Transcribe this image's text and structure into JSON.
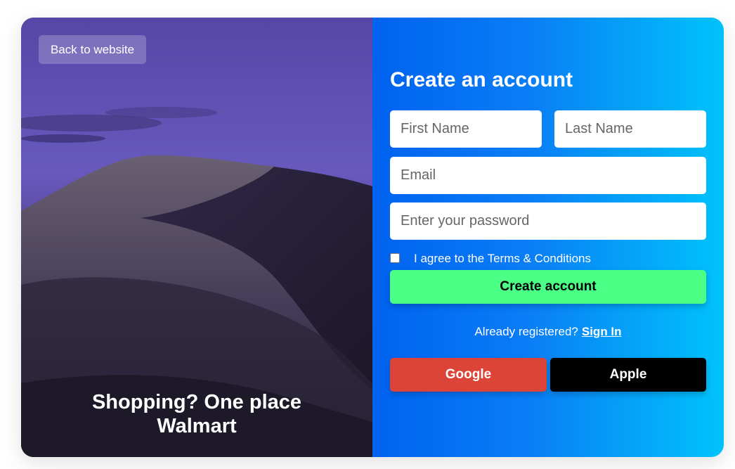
{
  "left_panel": {
    "back_button_label": "Back to website",
    "tagline_line1": "Shopping? One place",
    "tagline_line2": "Walmart"
  },
  "form": {
    "title": "Create an account",
    "first_name_placeholder": "First Name",
    "last_name_placeholder": "Last Name",
    "email_placeholder": "Email",
    "password_placeholder": "Enter your password",
    "terms_label": "I agree to the Terms & Conditions",
    "terms_checked": false,
    "submit_label": "Create account",
    "already_registered_text": "Already registered?",
    "sign_in_link": "Sign In",
    "google_button_label": "Google",
    "apple_button_label": "Apple"
  },
  "colors": {
    "submit_button": "#4cff85",
    "google_button": "#db4437",
    "apple_button": "#000000",
    "panel_gradient_start": "#0062f0",
    "panel_gradient_end": "#00c3fb"
  }
}
